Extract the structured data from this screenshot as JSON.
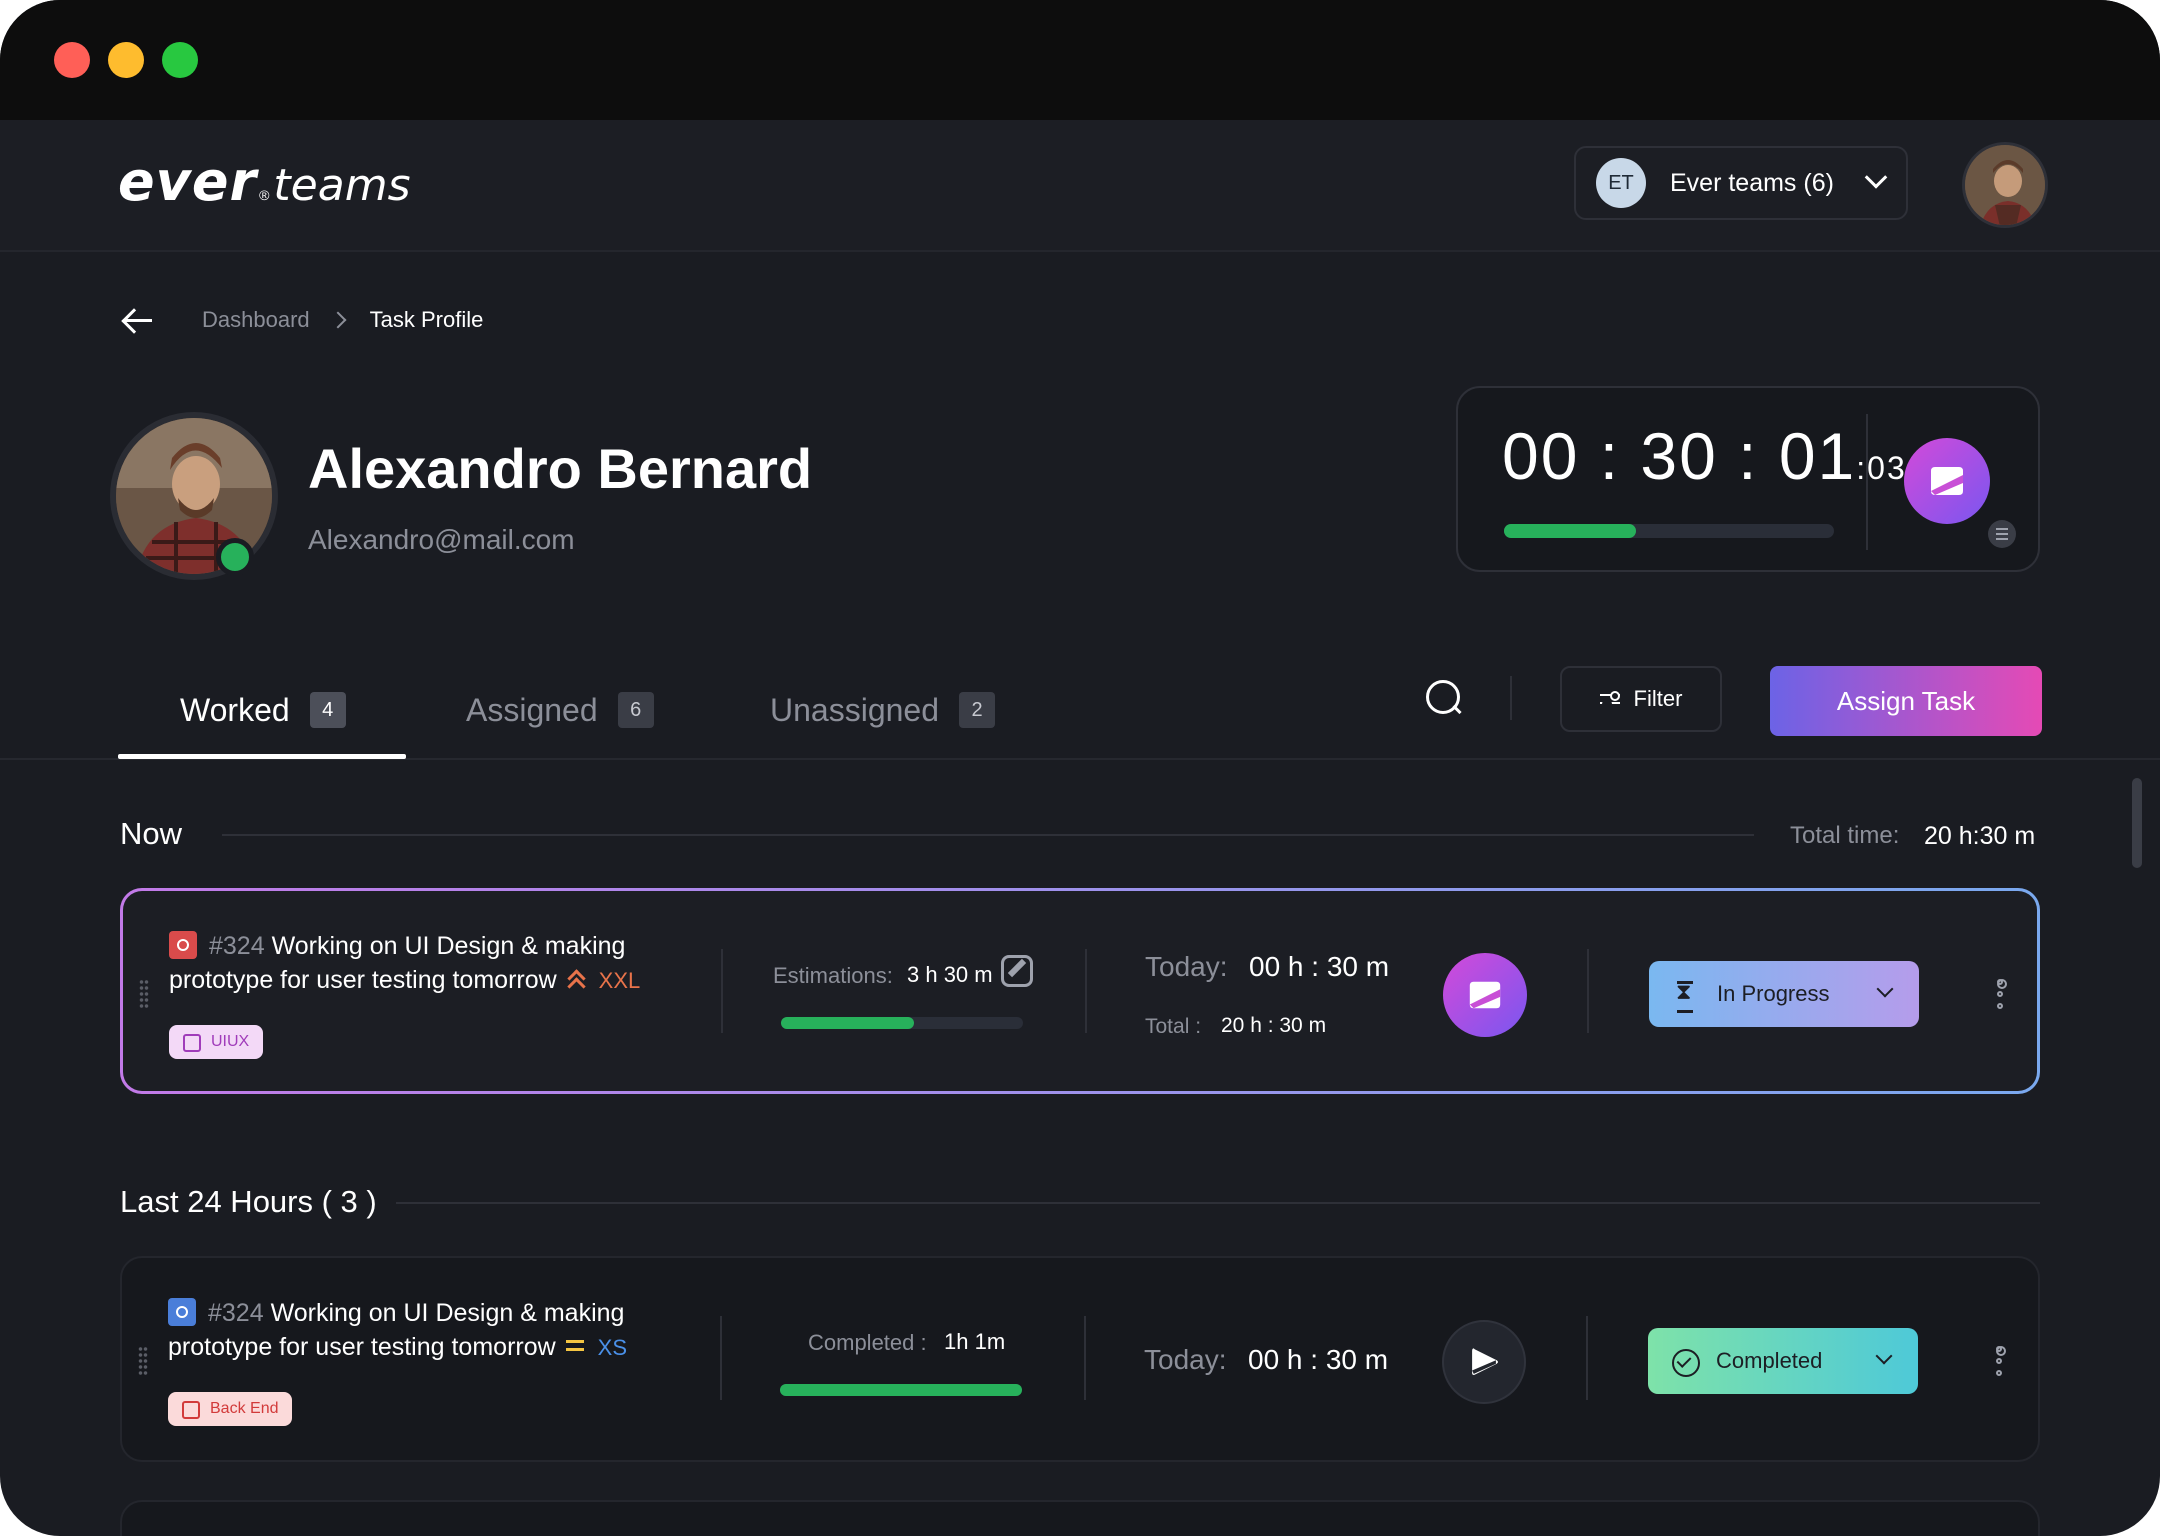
{
  "window": {
    "controls": [
      "close",
      "minimize",
      "maximize"
    ]
  },
  "header": {
    "logo_main": "ever",
    "logo_mark": "®",
    "logo_secondary": "teams",
    "team_badge": "ET",
    "team_name": "Ever teams (6)"
  },
  "breadcrumb": {
    "items": [
      "Dashboard",
      "Task Profile"
    ]
  },
  "profile": {
    "name": "Alexandro Bernard",
    "email": "Alexandro@mail.com",
    "status_color": "#27b15b"
  },
  "timer": {
    "time": "00 : 30 : 01",
    "ms": ":03",
    "progress_fraction": 0.4
  },
  "tabs": [
    {
      "label": "Worked",
      "count": "4",
      "active": true
    },
    {
      "label": "Assigned",
      "count": "6",
      "active": false
    },
    {
      "label": "Unassigned",
      "count": "2",
      "active": false
    }
  ],
  "toolbar": {
    "filter_label": "Filter",
    "assign_label": "Assign Task"
  },
  "now_section": {
    "label": "Now",
    "total_label": "Total time:",
    "total_value": "20 h:30 m"
  },
  "last24_section": {
    "label": "Last 24 Hours ( 3 )"
  },
  "tasks": [
    {
      "number": "#324",
      "title": " Working on UI Design & making prototype for user testing tomorrow",
      "type": "bug",
      "priority": "high",
      "size": "XXL",
      "tag": "UIUX",
      "metric_label": "Estimations:",
      "metric_value": "3 h 30 m",
      "progress_fraction": 0.55,
      "today_label": "Today:",
      "today_value": "00 h : 30 m",
      "total_label": "Total :",
      "total_value": "20 h : 30 m",
      "status": "In Progress",
      "accent": "#c27ae8"
    },
    {
      "number": "#324",
      "title": " Working on UI Design & making prototype for user testing tomorrow",
      "type": "story",
      "priority": "medium",
      "size": "XS",
      "tag": "Back End",
      "metric_label": "Completed :",
      "metric_value": "1h 1m",
      "progress_fraction": 1.0,
      "today_label": "Today:",
      "today_value": "00 h : 30 m",
      "status": "Completed",
      "accent": "#7ee2a9"
    }
  ]
}
